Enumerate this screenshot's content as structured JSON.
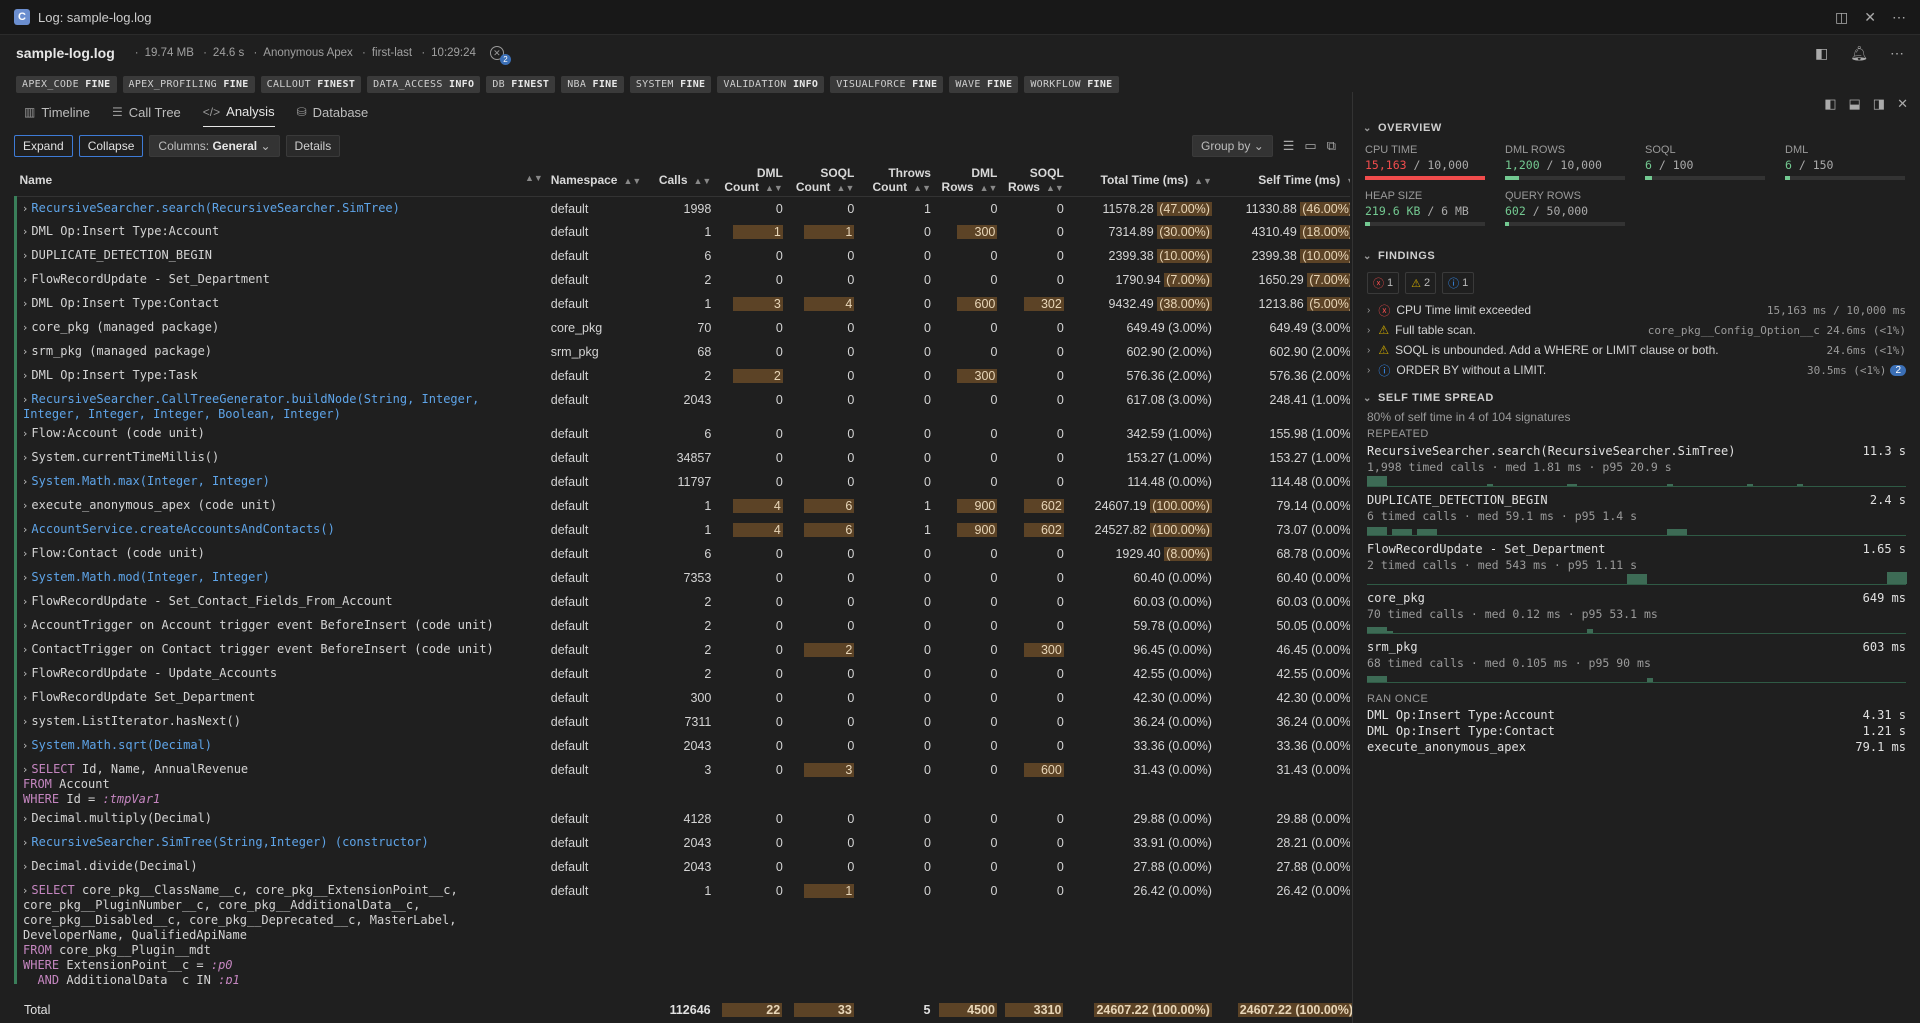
{
  "window": {
    "title": "Log: sample-log.log",
    "app_icon": "C"
  },
  "header": {
    "file_name": "sample-log.log",
    "size": "19.74 MB",
    "duration": "24.6 s",
    "user": "Anonymous Apex",
    "mode": "first-last",
    "time": "10:29:24",
    "issue_count": "2"
  },
  "chips": [
    {
      "name": "APEX_CODE",
      "level": "FINE"
    },
    {
      "name": "APEX_PROFILING",
      "level": "FINE"
    },
    {
      "name": "CALLOUT",
      "level": "FINEST"
    },
    {
      "name": "DATA_ACCESS",
      "level": "INFO"
    },
    {
      "name": "DB",
      "level": "FINEST"
    },
    {
      "name": "NBA",
      "level": "FINE"
    },
    {
      "name": "SYSTEM",
      "level": "FINE"
    },
    {
      "name": "VALIDATION",
      "level": "INFO"
    },
    {
      "name": "VISUALFORCE",
      "level": "FINE"
    },
    {
      "name": "WAVE",
      "level": "FINE"
    },
    {
      "name": "WORKFLOW",
      "level": "FINE"
    }
  ],
  "tabs": [
    "Timeline",
    "Call Tree",
    "Analysis",
    "Database"
  ],
  "toolbar": {
    "expand": "Expand",
    "collapse": "Collapse",
    "columns_label": "Columns:",
    "columns_value": "General",
    "details": "Details",
    "group_by": "Group by"
  },
  "columns": {
    "name": "Name",
    "namespace": "Namespace",
    "calls": "Calls",
    "dml_count": "DML Count",
    "soql_count": "SOQL Count",
    "throws_count": "Throws Count",
    "dml_rows": "DML Rows",
    "soql_rows": "SOQL Rows",
    "total_time": "Total Time (ms)",
    "self_time": "Self Time (ms)"
  },
  "rows": [
    {
      "name": "RecursiveSearcher.search(RecursiveSearcher.SimTree)",
      "link": true,
      "ns": "default",
      "calls": "1998",
      "dml": "0",
      "soql": "0",
      "throws": "1",
      "dmlrows": "0",
      "soqlrows": "0",
      "total": "11578.28",
      "totalpct": "(47.00%)",
      "self": "11330.88",
      "selfpct": "(46.00%)"
    },
    {
      "name": "DML Op:Insert Type:Account",
      "link": false,
      "ns": "default",
      "calls": "1",
      "dml": "1",
      "soql": "1",
      "throws": "0",
      "dmlrows": "300",
      "soqlrows": "0",
      "total": "7314.89",
      "totalpct": "(30.00%)",
      "self": "4310.49",
      "selfpct": "(18.00%)"
    },
    {
      "name": "DUPLICATE_DETECTION_BEGIN",
      "link": false,
      "ns": "default",
      "calls": "6",
      "dml": "0",
      "soql": "0",
      "throws": "0",
      "dmlrows": "0",
      "soqlrows": "0",
      "total": "2399.38",
      "totalpct": "(10.00%)",
      "self": "2399.38",
      "selfpct": "(10.00%)"
    },
    {
      "name": "FlowRecordUpdate - Set_Department",
      "link": false,
      "ns": "default",
      "calls": "2",
      "dml": "0",
      "soql": "0",
      "throws": "0",
      "dmlrows": "0",
      "soqlrows": "0",
      "total": "1790.94",
      "totalpct": "(7.00%)",
      "self": "1650.29",
      "selfpct": "(7.00%)"
    },
    {
      "name": "DML Op:Insert Type:Contact",
      "link": false,
      "ns": "default",
      "calls": "1",
      "dml": "3",
      "soql": "4",
      "throws": "0",
      "dmlrows": "600",
      "soqlrows": "302",
      "total": "9432.49",
      "totalpct": "(38.00%)",
      "self": "1213.86",
      "selfpct": "(5.00%)"
    },
    {
      "name": "core_pkg (managed package)",
      "link": false,
      "ns": "core_pkg",
      "calls": "70",
      "dml": "0",
      "soql": "0",
      "throws": "0",
      "dmlrows": "0",
      "soqlrows": "0",
      "total": "649.49",
      "totalpct": "(3.00%)",
      "self": "649.49",
      "selfpct": "(3.00%)"
    },
    {
      "name": "srm_pkg (managed package)",
      "link": false,
      "ns": "srm_pkg",
      "calls": "68",
      "dml": "0",
      "soql": "0",
      "throws": "0",
      "dmlrows": "0",
      "soqlrows": "0",
      "total": "602.90",
      "totalpct": "(2.00%)",
      "self": "602.90",
      "selfpct": "(2.00%)"
    },
    {
      "name": "DML Op:Insert Type:Task",
      "link": false,
      "ns": "default",
      "calls": "2",
      "dml": "2",
      "soql": "0",
      "throws": "0",
      "dmlrows": "300",
      "soqlrows": "0",
      "total": "576.36",
      "totalpct": "(2.00%)",
      "self": "576.36",
      "selfpct": "(2.00%)"
    },
    {
      "name": "RecursiveSearcher.CallTreeGenerator.buildNode(String, Integer,\nInteger, Integer, Integer, Boolean, Integer)",
      "link": true,
      "ns": "default",
      "calls": "2043",
      "dml": "0",
      "soql": "0",
      "throws": "0",
      "dmlrows": "0",
      "soqlrows": "0",
      "total": "617.08",
      "totalpct": "(3.00%)",
      "self": "248.41",
      "selfpct": "(1.00%)"
    },
    {
      "name": "Flow:Account (code unit)",
      "link": false,
      "ns": "default",
      "calls": "6",
      "dml": "0",
      "soql": "0",
      "throws": "0",
      "dmlrows": "0",
      "soqlrows": "0",
      "total": "342.59",
      "totalpct": "(1.00%)",
      "self": "155.98",
      "selfpct": "(1.00%)"
    },
    {
      "name": "System.currentTimeMillis()",
      "link": false,
      "ns": "default",
      "calls": "34857",
      "dml": "0",
      "soql": "0",
      "throws": "0",
      "dmlrows": "0",
      "soqlrows": "0",
      "total": "153.27",
      "totalpct": "(1.00%)",
      "self": "153.27",
      "selfpct": "(1.00%)"
    },
    {
      "name": "System.Math.max(Integer, Integer)",
      "link": true,
      "ns": "default",
      "calls": "11797",
      "dml": "0",
      "soql": "0",
      "throws": "0",
      "dmlrows": "0",
      "soqlrows": "0",
      "total": "114.48",
      "totalpct": "(0.00%)",
      "self": "114.48",
      "selfpct": "(0.00%)"
    },
    {
      "name": "execute_anonymous_apex (code unit)",
      "link": false,
      "ns": "default",
      "calls": "1",
      "dml": "4",
      "soql": "6",
      "throws": "1",
      "dmlrows": "900",
      "soqlrows": "602",
      "total": "24607.19",
      "totalpct": "(100.00%)",
      "self": "79.14",
      "selfpct": "(0.00%)"
    },
    {
      "name": "AccountService.createAccountsAndContacts()",
      "link": true,
      "ns": "default",
      "calls": "1",
      "dml": "4",
      "soql": "6",
      "throws": "1",
      "dmlrows": "900",
      "soqlrows": "602",
      "total": "24527.82",
      "totalpct": "(100.00%)",
      "self": "73.07",
      "selfpct": "(0.00%)"
    },
    {
      "name": "Flow:Contact (code unit)",
      "link": false,
      "ns": "default",
      "calls": "6",
      "dml": "0",
      "soql": "0",
      "throws": "0",
      "dmlrows": "0",
      "soqlrows": "0",
      "total": "1929.40",
      "totalpct": "(8.00%)",
      "self": "68.78",
      "selfpct": "(0.00%)"
    },
    {
      "name": "System.Math.mod(Integer, Integer)",
      "link": true,
      "ns": "default",
      "calls": "7353",
      "dml": "0",
      "soql": "0",
      "throws": "0",
      "dmlrows": "0",
      "soqlrows": "0",
      "total": "60.40",
      "totalpct": "(0.00%)",
      "self": "60.40",
      "selfpct": "(0.00%)"
    },
    {
      "name": "FlowRecordUpdate - Set_Contact_Fields_From_Account",
      "link": false,
      "ns": "default",
      "calls": "2",
      "dml": "0",
      "soql": "0",
      "throws": "0",
      "dmlrows": "0",
      "soqlrows": "0",
      "total": "60.03",
      "totalpct": "(0.00%)",
      "self": "60.03",
      "selfpct": "(0.00%)"
    },
    {
      "name": "AccountTrigger on Account trigger event BeforeInsert (code unit)",
      "link": false,
      "ns": "default",
      "calls": "2",
      "dml": "0",
      "soql": "0",
      "throws": "0",
      "dmlrows": "0",
      "soqlrows": "0",
      "total": "59.78",
      "totalpct": "(0.00%)",
      "self": "50.05",
      "selfpct": "(0.00%)"
    },
    {
      "name": "ContactTrigger on Contact trigger event BeforeInsert (code unit)",
      "link": false,
      "ns": "default",
      "calls": "2",
      "dml": "0",
      "soql": "2",
      "throws": "0",
      "dmlrows": "0",
      "soqlrows": "300",
      "total": "96.45",
      "totalpct": "(0.00%)",
      "self": "46.45",
      "selfpct": "(0.00%)"
    },
    {
      "name": "FlowRecordUpdate - Update_Accounts",
      "link": false,
      "ns": "default",
      "calls": "2",
      "dml": "0",
      "soql": "0",
      "throws": "0",
      "dmlrows": "0",
      "soqlrows": "0",
      "total": "42.55",
      "totalpct": "(0.00%)",
      "self": "42.55",
      "selfpct": "(0.00%)"
    },
    {
      "name": "FlowRecordUpdate Set_Department",
      "link": false,
      "ns": "default",
      "calls": "300",
      "dml": "0",
      "soql": "0",
      "throws": "0",
      "dmlrows": "0",
      "soqlrows": "0",
      "total": "42.30",
      "totalpct": "(0.00%)",
      "self": "42.30",
      "selfpct": "(0.00%)"
    },
    {
      "name": "system.ListIterator.hasNext()",
      "link": false,
      "ns": "default",
      "calls": "7311",
      "dml": "0",
      "soql": "0",
      "throws": "0",
      "dmlrows": "0",
      "soqlrows": "0",
      "total": "36.24",
      "totalpct": "(0.00%)",
      "self": "36.24",
      "selfpct": "(0.00%)"
    },
    {
      "name": "System.Math.sqrt(Decimal)",
      "link": true,
      "ns": "default",
      "calls": "2043",
      "dml": "0",
      "soql": "0",
      "throws": "0",
      "dmlrows": "0",
      "soqlrows": "0",
      "total": "33.36",
      "totalpct": "(0.00%)",
      "self": "33.36",
      "selfpct": "(0.00%)"
    },
    {
      "name": "SELECT Id, Name, AnnualRevenue\nFROM Account\nWHERE Id = :tmpVar1",
      "link": false,
      "sql": true,
      "ns": "default",
      "calls": "3",
      "dml": "0",
      "soql": "3",
      "throws": "0",
      "dmlrows": "0",
      "soqlrows": "600",
      "total": "31.43",
      "totalpct": "(0.00%)",
      "self": "31.43",
      "selfpct": "(0.00%)"
    },
    {
      "name": "Decimal.multiply(Decimal)",
      "link": false,
      "ns": "default",
      "calls": "4128",
      "dml": "0",
      "soql": "0",
      "throws": "0",
      "dmlrows": "0",
      "soqlrows": "0",
      "total": "29.88",
      "totalpct": "(0.00%)",
      "self": "29.88",
      "selfpct": "(0.00%)"
    },
    {
      "name": "RecursiveSearcher.SimTree(String,Integer) (constructor)",
      "link": true,
      "ns": "default",
      "calls": "2043",
      "dml": "0",
      "soql": "0",
      "throws": "0",
      "dmlrows": "0",
      "soqlrows": "0",
      "total": "33.91",
      "totalpct": "(0.00%)",
      "self": "28.21",
      "selfpct": "(0.00%)"
    },
    {
      "name": "Decimal.divide(Decimal)",
      "link": false,
      "ns": "default",
      "calls": "2043",
      "dml": "0",
      "soql": "0",
      "throws": "0",
      "dmlrows": "0",
      "soqlrows": "0",
      "total": "27.88",
      "totalpct": "(0.00%)",
      "self": "27.88",
      "selfpct": "(0.00%)"
    },
    {
      "name": "SELECT core_pkg__ClassName__c, core_pkg__ExtensionPoint__c,\ncore_pkg__PluginNumber__c, core_pkg__AdditionalData__c,\ncore_pkg__Disabled__c, core_pkg__Deprecated__c, MasterLabel,\nDeveloperName, QualifiedApiName\nFROM core_pkg__Plugin__mdt\nWHERE ExtensionPoint__c = :p0\n  AND AdditionalData__c IN :p1",
      "link": false,
      "sql": true,
      "ns": "default",
      "calls": "1",
      "dml": "0",
      "soql": "1",
      "throws": "0",
      "dmlrows": "0",
      "soqlrows": "0",
      "total": "26.42",
      "totalpct": "(0.00%)",
      "self": "26.42",
      "selfpct": "(0.00%)"
    }
  ],
  "total": {
    "label": "Total",
    "calls": "112646",
    "dml": "22",
    "soql": "33",
    "throws": "5",
    "dmlrows": "4500",
    "soqlrows": "3310",
    "total": "24607.22 (100.00%)",
    "self": "24607.22 (100.00%)"
  },
  "overview": {
    "title": "OVERVIEW",
    "items": [
      {
        "label": "CPU TIME",
        "value": "15,163",
        "limit": " / 10,000",
        "status": "red",
        "fill": 1.0
      },
      {
        "label": "DML ROWS",
        "value": "1,200",
        "limit": " / 10,000",
        "status": "green",
        "fill": 0.12
      },
      {
        "label": "SOQL",
        "value": "6",
        "limit": " / 100",
        "status": "green",
        "fill": 0.06
      },
      {
        "label": "DML",
        "value": "6",
        "limit": " / 150",
        "status": "green",
        "fill": 0.04
      },
      {
        "label": "HEAP SIZE",
        "value": "219.6 KB",
        "limit": " / 6 MB",
        "status": "green",
        "fill": 0.04
      },
      {
        "label": "QUERY ROWS",
        "value": "602",
        "limit": " / 50,000",
        "status": "green",
        "fill": 0.012
      }
    ]
  },
  "findings": {
    "title": "FINDINGS",
    "counts": {
      "error": "1",
      "warn": "2",
      "info": "1"
    },
    "items": [
      {
        "type": "error",
        "text": "CPU Time limit exceeded",
        "right": "15,163 ms / 10,000 ms"
      },
      {
        "type": "warn",
        "text": "Full table scan.",
        "right": "core_pkg__Config_Option__c 24.6ms (<1%)"
      },
      {
        "type": "warn",
        "text": "SOQL is unbounded. Add a WHERE or LIMIT clause or both.",
        "right": "24.6ms (<1%)"
      },
      {
        "type": "info",
        "text": "ORDER BY without a LIMIT.",
        "right": "30.5ms (<1%)",
        "count": "2"
      }
    ]
  },
  "spread": {
    "title": "SELF TIME SPREAD",
    "subtitle": "80% of self time in 4 of 104 signatures",
    "repeated_label": "REPEATED",
    "repeated": [
      {
        "name": "RecursiveSearcher.search(RecursiveSearcher.SimTree)",
        "value": "11.3 s",
        "sub": "1,998 timed calls · med 1.81 ms · p95 20.9 s"
      },
      {
        "name": "DUPLICATE_DETECTION_BEGIN",
        "value": "2.4 s",
        "sub": "6 timed calls · med 59.1 ms · p95 1.4 s"
      },
      {
        "name": "FlowRecordUpdate - Set_Department",
        "value": "1.65 s",
        "sub": "2 timed calls · med 543 ms · p95 1.11 s"
      },
      {
        "name": "core_pkg",
        "value": "649 ms",
        "sub": "70 timed calls · med 0.12 ms · p95 53.1 ms"
      },
      {
        "name": "srm_pkg",
        "value": "603 ms",
        "sub": "68 timed calls · med 0.105 ms · p95 90 ms"
      }
    ],
    "once_label": "RAN ONCE",
    "once": [
      {
        "name": "DML Op:Insert Type:Account",
        "value": "4.31 s"
      },
      {
        "name": "DML Op:Insert Type:Contact",
        "value": "1.21 s"
      },
      {
        "name": "execute_anonymous_apex",
        "value": "79.1 ms"
      }
    ]
  }
}
